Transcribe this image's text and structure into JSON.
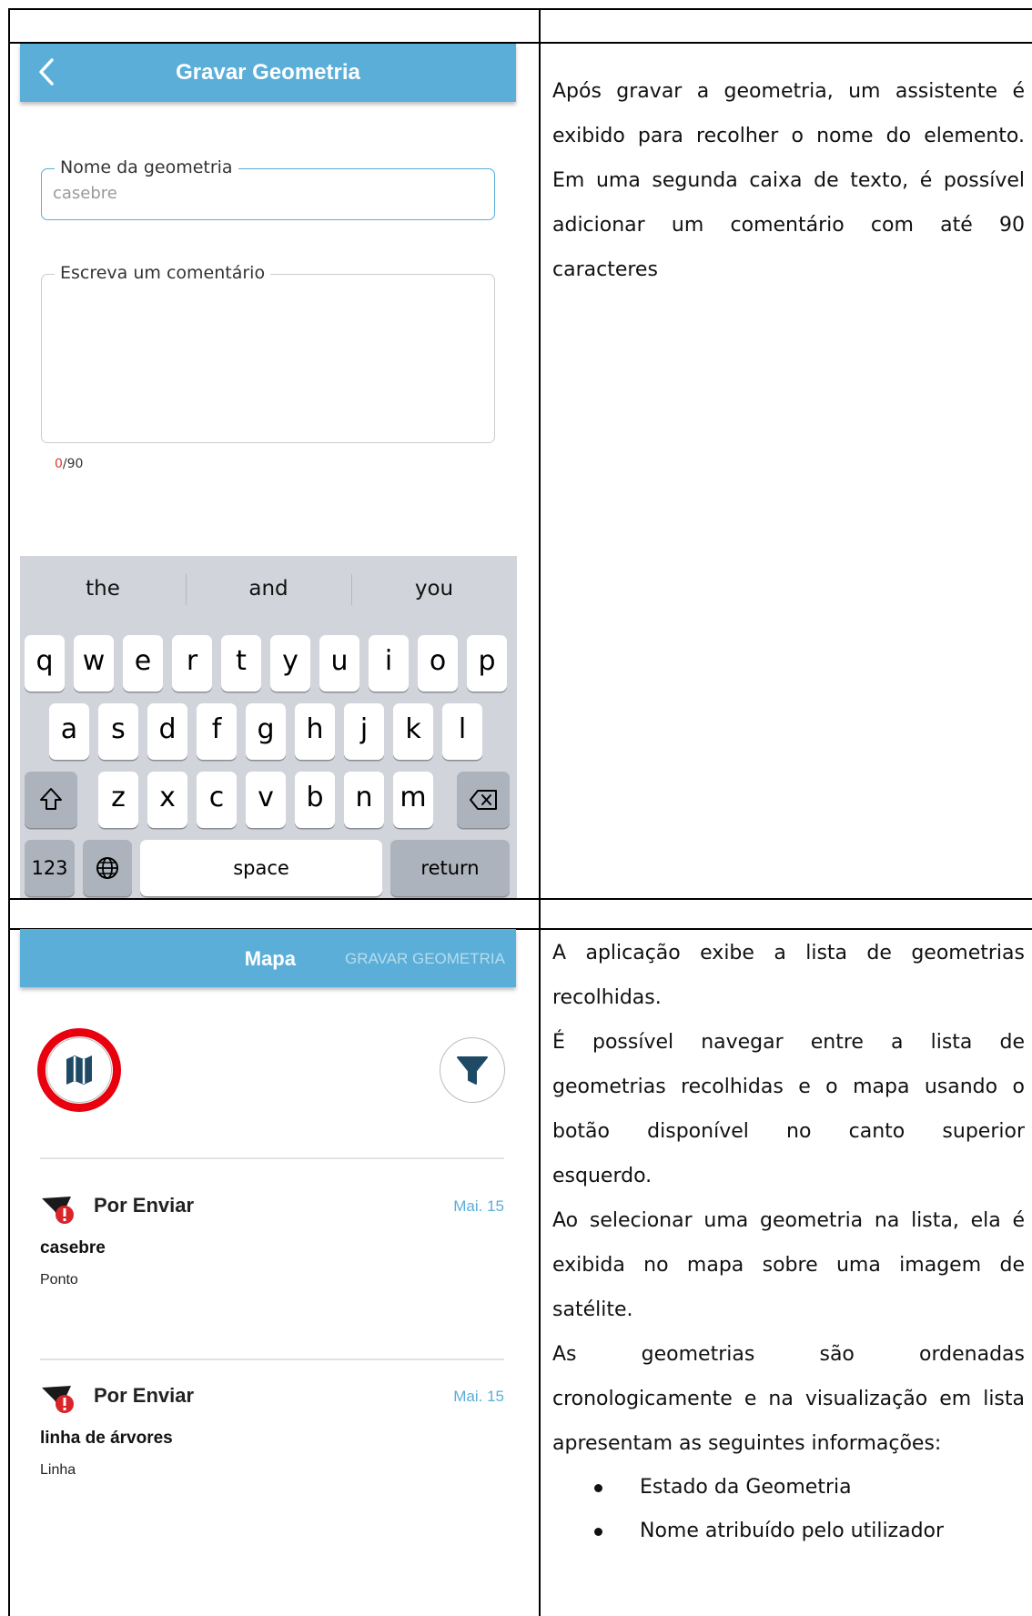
{
  "form_screen": {
    "title": "Gravar Geometria",
    "name_field": {
      "label": "Nome da geometria",
      "value": "casebre"
    },
    "comment_field": {
      "label": "Escreva um comentário",
      "value": ""
    },
    "counter": {
      "current": "0",
      "max": "/90"
    },
    "keyboard": {
      "suggestions": [
        "the",
        "and",
        "you"
      ],
      "row1": [
        "q",
        "w",
        "e",
        "r",
        "t",
        "y",
        "u",
        "i",
        "o",
        "p"
      ],
      "row2": [
        "a",
        "s",
        "d",
        "f",
        "g",
        "h",
        "j",
        "k",
        "l"
      ],
      "row3": [
        "z",
        "x",
        "c",
        "v",
        "b",
        "n",
        "m"
      ],
      "numbers_key": "123",
      "space_key": "space",
      "return_key": "return",
      "shift_icon": "shift-icon",
      "backspace_icon": "backspace-icon",
      "globe_icon": "globe-icon"
    }
  },
  "form_description": [
    "Após gravar a geometria, um assistente é",
    "exibido para recolher o nome do elemento.",
    "Em uma segunda caixa de texto, é possível",
    "adicionar um comentário com até 90",
    "caracteres"
  ],
  "list_screen": {
    "tabs": {
      "active": "Mapa",
      "inactive": "GRAVAR GEOMETRIA"
    },
    "map_button_icon": "map-icon",
    "filter_button_icon": "filter-icon",
    "items": [
      {
        "status": "Por Enviar",
        "date": "Mai. 15",
        "name": "casebre",
        "type": "Ponto"
      },
      {
        "status": "Por Enviar",
        "date": "Mai. 15",
        "name": "linha de árvores",
        "type": "Linha"
      }
    ],
    "colors": {
      "accent": "#5aaed8",
      "highlight": "#e8000f",
      "status_badge": "#d9252a"
    }
  },
  "list_description": {
    "lines": [
      "A aplicação exibe a lista de geometrias",
      "recolhidas.",
      "É possível navegar entre a lista de",
      "geometrias recolhidas e o mapa usando o",
      "botão disponível no canto superior",
      "esquerdo.",
      "Ao selecionar uma geometria na lista, ela é",
      "exibida no mapa sobre uma imagem de",
      "satélite.",
      "As geometrias são ordenadas",
      "cronologicamente e na visualização em lista",
      "apresentam as seguintes informações:"
    ],
    "bullets": [
      "Estado da Geometria",
      "Nome atribuído pelo utilizador"
    ]
  }
}
